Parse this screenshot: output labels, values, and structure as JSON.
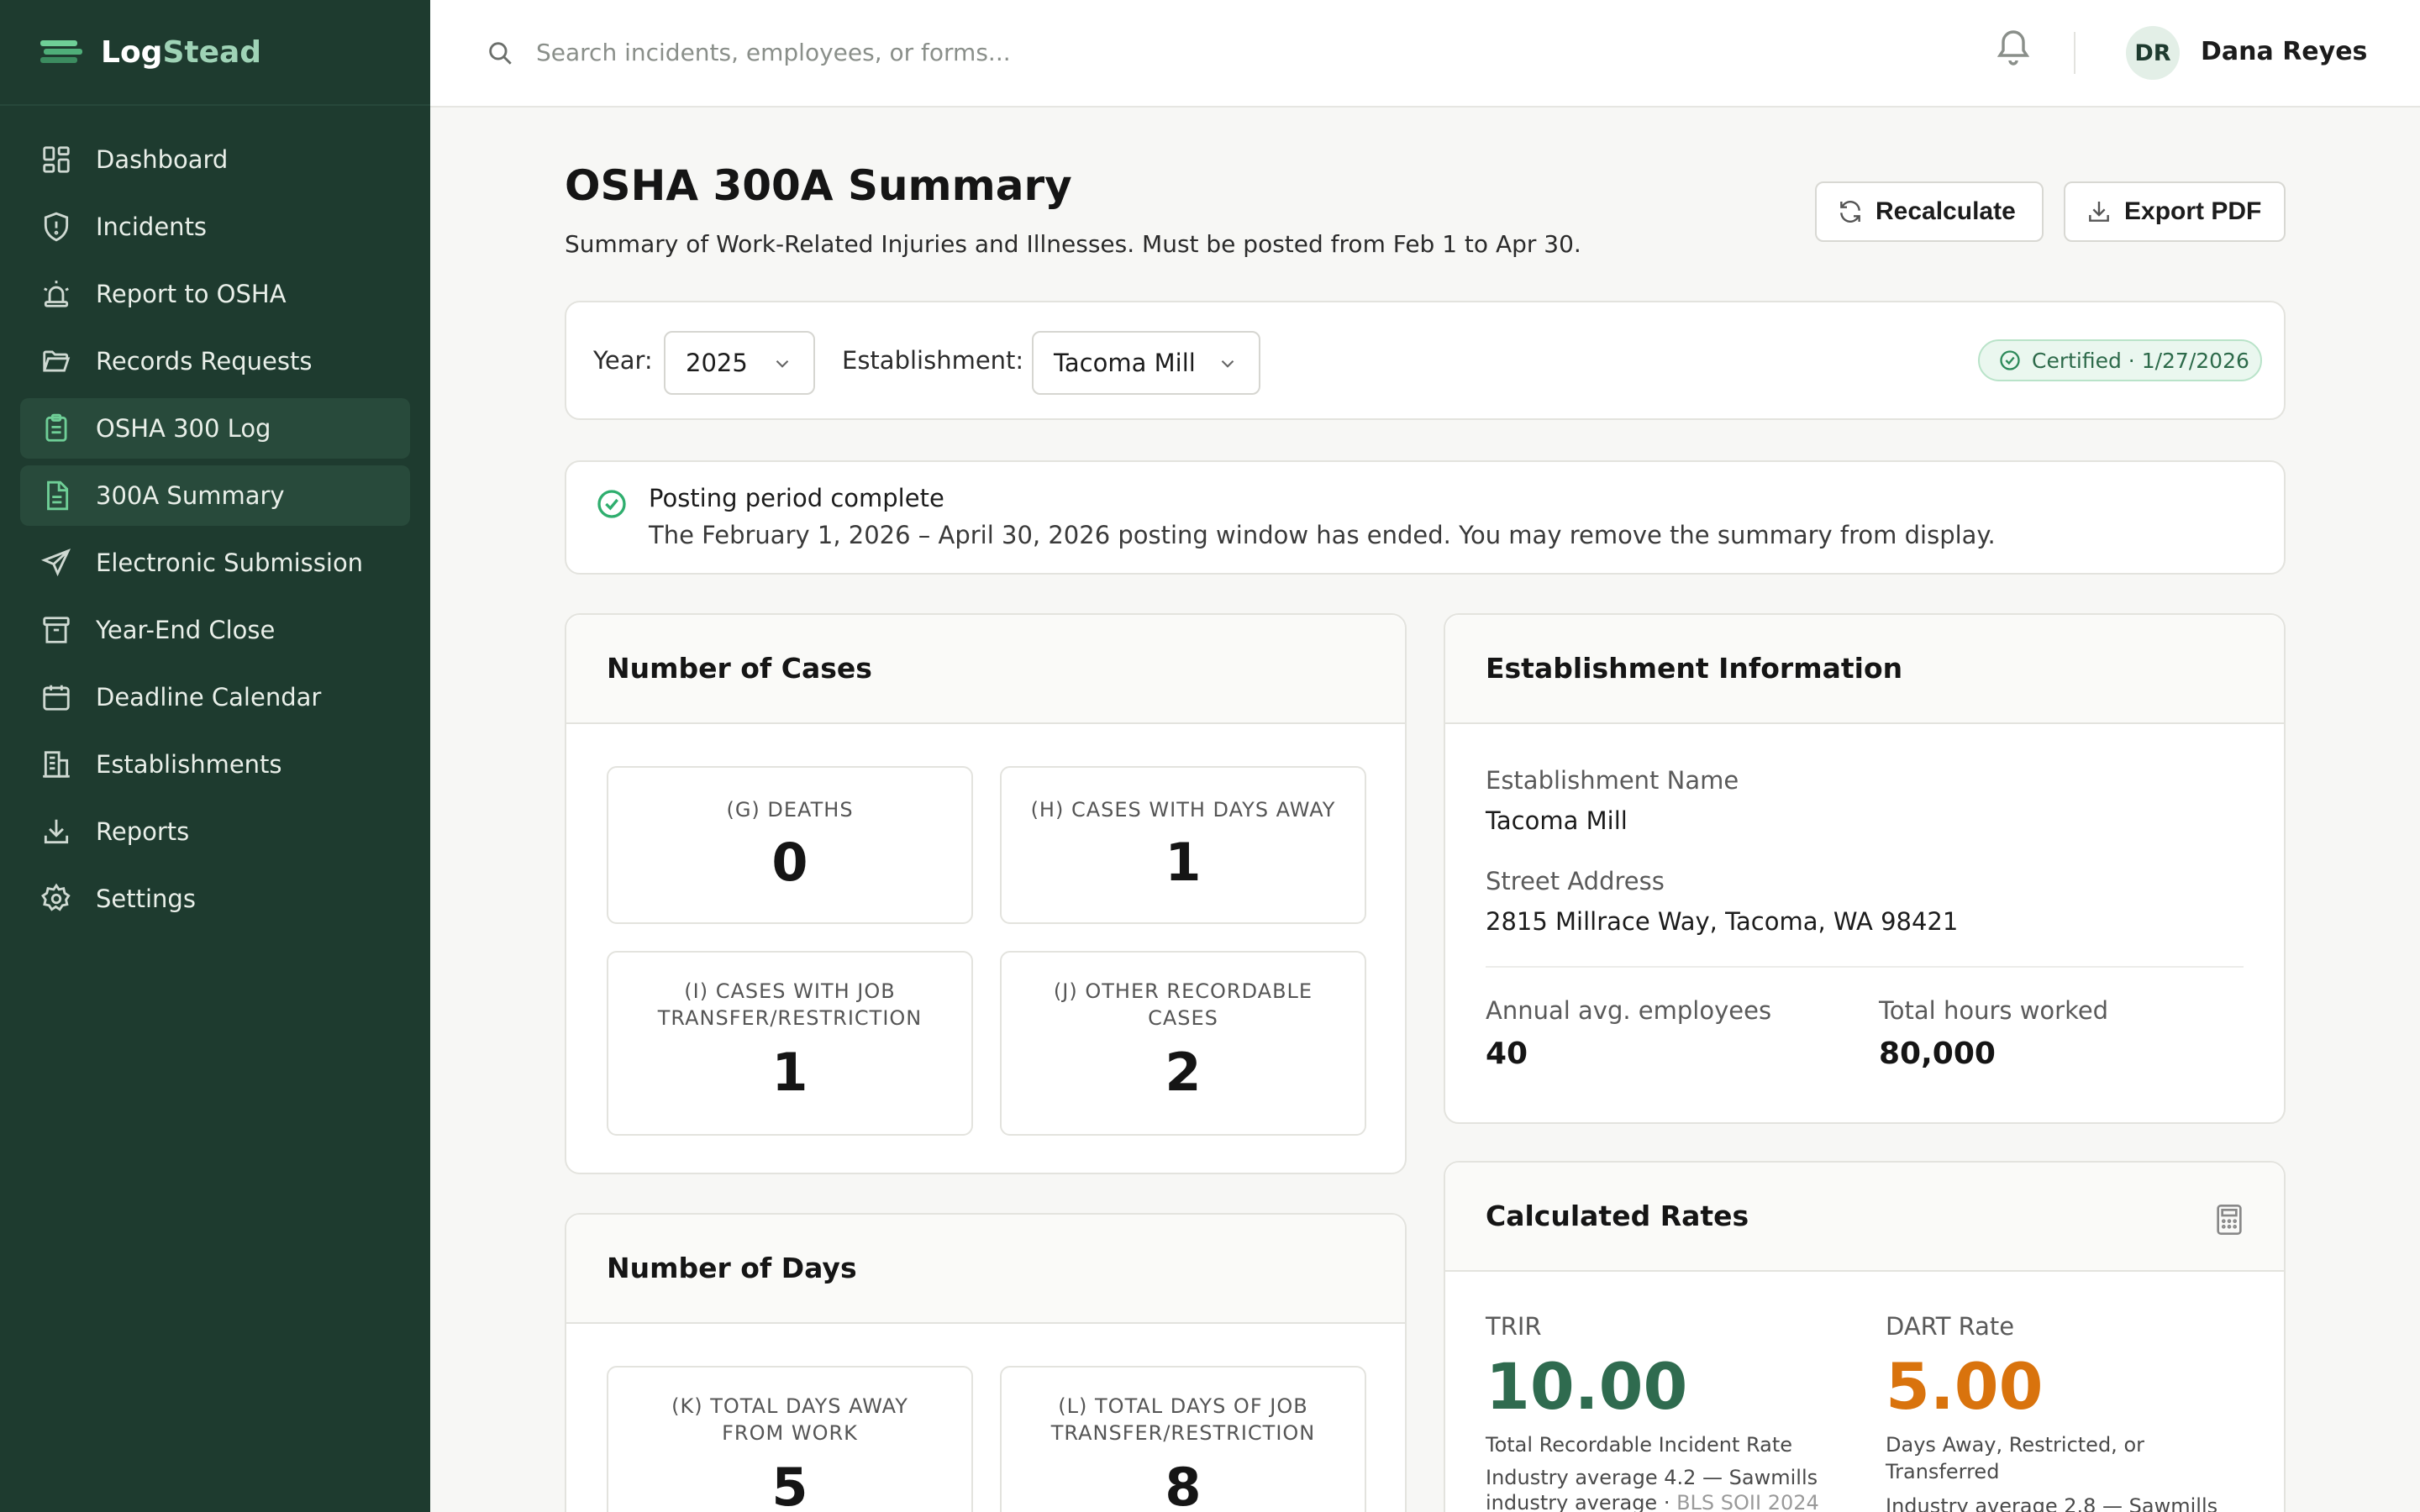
{
  "brand": {
    "name_part1": "Log",
    "name_part2": "Stead"
  },
  "sidebar": {
    "items": [
      {
        "label": "Dashboard",
        "icon": "grid-icon"
      },
      {
        "label": "Incidents",
        "icon": "shield-alert-icon"
      },
      {
        "label": "Report to OSHA",
        "icon": "siren-icon"
      },
      {
        "label": "Records Requests",
        "icon": "folder-open-icon"
      },
      {
        "label": "OSHA 300 Log",
        "icon": "clipboard-icon",
        "active": true
      },
      {
        "label": "300A Summary",
        "icon": "file-text-icon",
        "active": true
      },
      {
        "label": "Electronic Submission",
        "icon": "send-icon"
      },
      {
        "label": "Year-End Close",
        "icon": "archive-icon"
      },
      {
        "label": "Deadline Calendar",
        "icon": "calendar-icon"
      },
      {
        "label": "Establishments",
        "icon": "building-icon"
      },
      {
        "label": "Reports",
        "icon": "download-icon"
      },
      {
        "label": "Settings",
        "icon": "gear-icon"
      }
    ]
  },
  "topbar": {
    "search_placeholder": "Search incidents, employees, or forms...",
    "user_initials": "DR",
    "user_name": "Dana Reyes"
  },
  "page": {
    "title": "OSHA 300A Summary",
    "subtitle": "Summary of Work-Related Injuries and Illnesses. Must be posted from Feb 1 to Apr 30.",
    "recalculate_label": "Recalculate",
    "export_label": "Export PDF"
  },
  "filters": {
    "year_label": "Year:",
    "year_value": "2025",
    "establishment_label": "Establishment:",
    "establishment_value": "Tacoma Mill",
    "certified_badge": "Certified · 1/27/2026"
  },
  "alert": {
    "title": "Posting period complete",
    "text": "The February 1, 2026 – April 30, 2026 posting window has ended. You may remove the summary from display."
  },
  "cases": {
    "title": "Number of Cases",
    "stats": [
      {
        "label": "(G) DEATHS",
        "value": "0"
      },
      {
        "label": "(H) CASES WITH DAYS AWAY",
        "value": "1"
      },
      {
        "label_line1": "(I) CASES WITH JOB",
        "label_line2": "TRANSFER/RESTRICTION",
        "value": "1"
      },
      {
        "label_line1": "(J) OTHER RECORDABLE",
        "label_line2": "CASES",
        "value": "2"
      }
    ]
  },
  "days": {
    "title": "Number of Days",
    "stats": [
      {
        "label_line1": "(K) TOTAL DAYS AWAY",
        "label_line2": "FROM WORK",
        "value": "5"
      },
      {
        "label_line1": "(L) TOTAL DAYS OF JOB",
        "label_line2": "TRANSFER/RESTRICTION",
        "value": "8"
      }
    ]
  },
  "establishment": {
    "title": "Establishment Information",
    "name_label": "Establishment Name",
    "name_value": "Tacoma Mill",
    "address_label": "Street Address",
    "address_value": "2815 Millrace Way, Tacoma, WA 98421",
    "employees_label": "Annual avg. employees",
    "employees_value": "40",
    "hours_label": "Total hours worked",
    "hours_value": "80,000"
  },
  "rates": {
    "title": "Calculated Rates",
    "trir_label": "TRIR",
    "trir_value": "10.00",
    "trir_desc": "Total Recordable Incident Rate",
    "trir_note_line1": "Industry average 4.2 — Sawmills",
    "trir_note_line2": "industry average · ",
    "trir_note_source": "BLS SOII 2024",
    "dart_label": "DART Rate",
    "dart_value": "5.00",
    "dart_desc_line1": "Days Away, Restricted, or",
    "dart_desc_line2": "Transferred",
    "dart_note_line1": "Industry average 2.8 — Sawmills",
    "colors": {
      "trir": "#2f6b4f",
      "dart": "#d9730d"
    }
  }
}
